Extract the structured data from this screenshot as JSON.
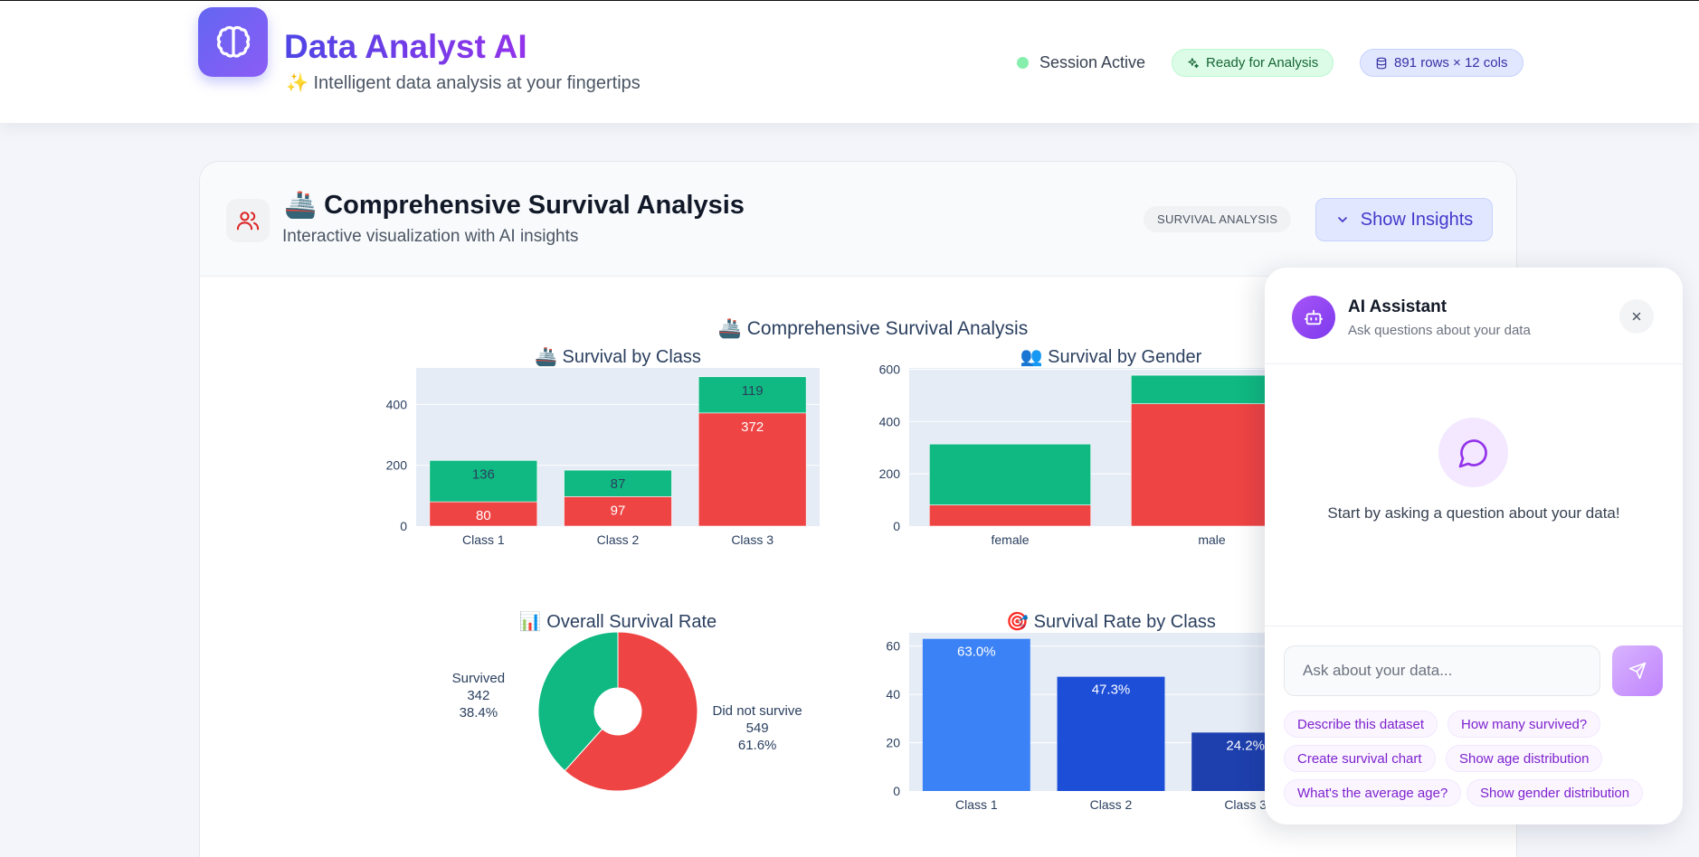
{
  "header": {
    "title": "Data Analyst AI",
    "subtitle": "✨ Intelligent data analysis at your fingertips",
    "session_status": "Session Active",
    "ready_badge": "Ready for Analysis",
    "rows_badge": "891 rows × 12 cols",
    "logo_icon": "brain-icon",
    "ready_icon": "sparkles-icon",
    "rows_icon": "database-icon"
  },
  "card": {
    "title": "🚢 Comprehensive Survival Analysis",
    "subtitle": "Interactive visualization with AI insights",
    "tag": "SURVIVAL ANALYSIS",
    "insights_button": "Show Insights",
    "icon": "users-icon"
  },
  "chart_data": [
    {
      "type": "bar",
      "title": "🚢 Survival by Class",
      "figure_title": "🚢 Comprehensive Survival Analysis",
      "stacked": true,
      "categories": [
        "Class 1",
        "Class 2",
        "Class 3"
      ],
      "series": [
        {
          "name": "",
          "values": [
            80,
            97,
            372
          ],
          "color": "#ef4444"
        },
        {
          "name": "",
          "values": [
            136,
            87,
            119
          ],
          "color": "#10b981"
        }
      ],
      "ylim": [
        0,
        520
      ],
      "yticks": [
        0,
        200,
        400
      ],
      "grid": true
    },
    {
      "type": "bar",
      "title": "👥 Survival by Gender",
      "stacked": true,
      "categories": [
        "female",
        "male"
      ],
      "series": [
        {
          "name": "",
          "values": [
            81,
            468
          ],
          "color": "#ef4444"
        },
        {
          "name": "",
          "values": [
            233,
            109
          ],
          "color": "#10b981"
        }
      ],
      "ylim": [
        0,
        605
      ],
      "yticks": [
        0,
        200,
        400,
        600
      ],
      "grid": true
    },
    {
      "type": "pie",
      "title": "📊 Overall Survival Rate",
      "donut": true,
      "slices": [
        {
          "label": "Did not survive",
          "value": 549,
          "percent": "61.6%",
          "color": "#ef4444"
        },
        {
          "label": "Survived",
          "value": 342,
          "percent": "38.4%",
          "color": "#10b981"
        }
      ]
    },
    {
      "type": "bar",
      "title": "🎯 Survival Rate by Class",
      "categories": [
        "Class 1",
        "Class 2",
        "Class 3"
      ],
      "values": [
        63.0,
        47.3,
        24.2
      ],
      "labels": [
        "63.0%",
        "47.3%",
        "24.2%"
      ],
      "colors": [
        "#3b82f6",
        "#1d4ed8",
        "#1e40af"
      ],
      "ylim": [
        0,
        65.5
      ],
      "yticks": [
        0,
        20,
        40,
        60
      ],
      "grid": true
    }
  ],
  "assistant": {
    "title": "AI Assistant",
    "subtitle": "Ask questions about your data",
    "empty_text": "Start by asking a question about your data!",
    "input_placeholder": "Ask about your data...",
    "suggestions": [
      "Describe this dataset",
      "How many survived?",
      "Create survival chart",
      "Show age distribution",
      "What's the average age?",
      "Show gender distribution"
    ],
    "avatar_icon": "robot-icon",
    "empty_icon": "chat-bubble-icon",
    "send_icon": "send-icon",
    "close_icon": "close-icon"
  }
}
